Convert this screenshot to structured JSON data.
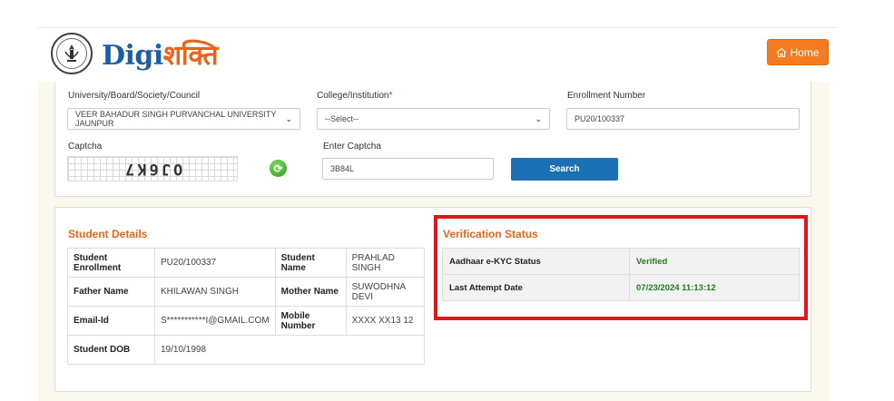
{
  "header": {
    "logo_prefix": "Digi",
    "logo_suffix": "शक्ति",
    "home_label": "Home"
  },
  "search": {
    "university_label": "University/Board/Society/Council",
    "university_value": "VEER BAHADUR SINGH PURVANCHAL UNIVERSITY JAUNPUR",
    "college_label": "College/Institution",
    "college_required": "*",
    "college_value": "--Select--",
    "enrollment_label": "Enrollment Number",
    "enrollment_value": "PU20/100337",
    "captcha_label": "Captcha",
    "captcha_text": "OJ6K7",
    "enter_captcha_label": "Enter Captcha",
    "enter_captcha_value": "3B84L",
    "search_label": "Search"
  },
  "student_details": {
    "title": "Student Details",
    "rows": [
      {
        "l1": "Student Enrollment",
        "v1": "PU20/100337",
        "l2": "Student Name",
        "v2": "PRAHLAD SINGH"
      },
      {
        "l1": "Father Name",
        "v1": "KHILAWAN SINGH",
        "l2": "Mother Name",
        "v2": "SUWODHNA DEVI"
      },
      {
        "l1": "Email-Id",
        "v1": "S***********I@GMAIL.COM",
        "l2": "Mobile Number",
        "v2": "XXXX XX13 12"
      },
      {
        "l1": "Student DOB",
        "v1": "19/10/1998"
      }
    ]
  },
  "verification": {
    "title": "Verification Status",
    "rows": [
      {
        "label": "Aadhaar e-KYC Status",
        "value": "Verified"
      },
      {
        "label": "Last Attempt Date",
        "value": "07/23/2024 11:13:12"
      }
    ]
  }
}
